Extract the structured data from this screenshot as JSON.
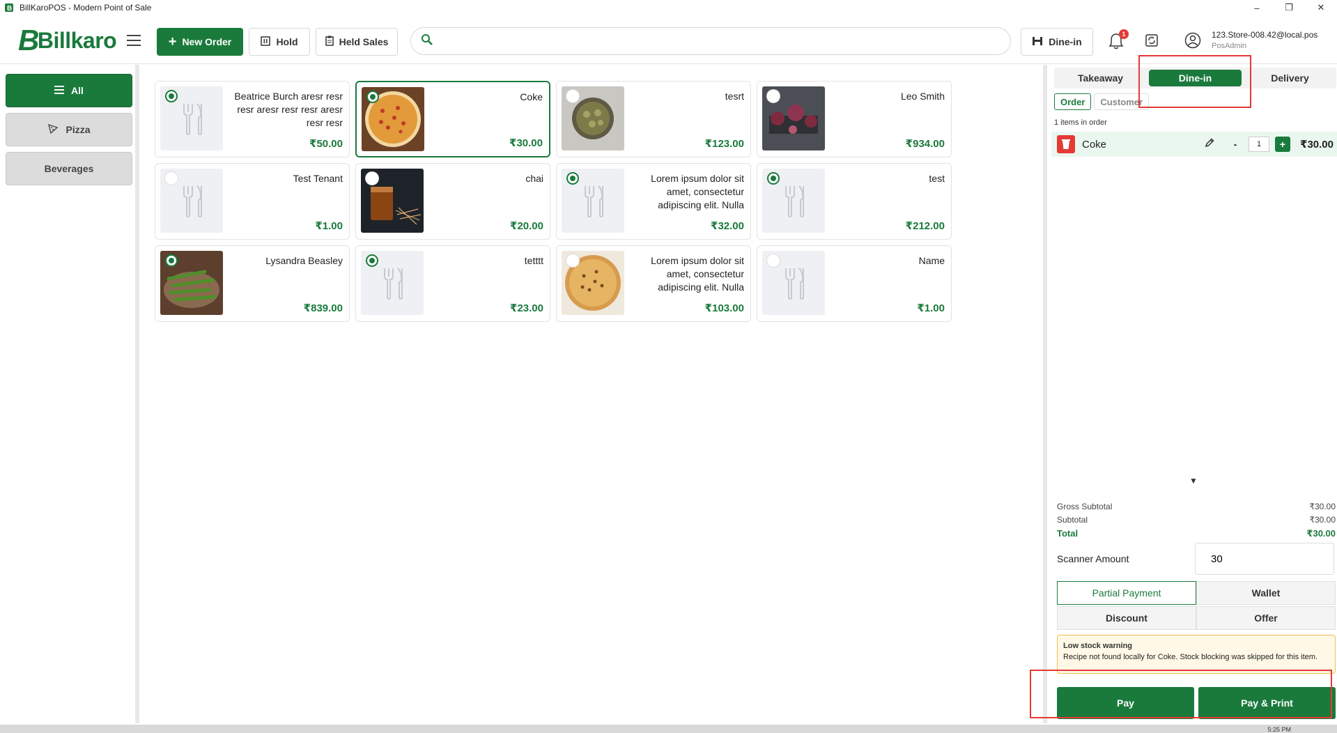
{
  "window": {
    "title": "BillKaroPOS - Modern Point of Sale",
    "controls": [
      "–",
      "❐",
      "✕"
    ]
  },
  "header": {
    "logo_text": "Billkaro",
    "logo_mark": "B",
    "new_order_label": "New Order",
    "hold_label": "Hold",
    "held_sales_label": "Held Sales",
    "search_placeholder": "",
    "order_type_label": "Dine-in",
    "notification_count": "1",
    "user_email": "123.Store-008.42@local.pos",
    "user_role": "PosAdmin"
  },
  "categories": [
    {
      "label": "All",
      "icon": "list-icon",
      "active": true
    },
    {
      "label": "Pizza",
      "icon": "pizza-icon",
      "active": false
    },
    {
      "label": "Beverages",
      "icon": "",
      "active": false
    }
  ],
  "products": [
    {
      "name": "Beatrice Burch  aresr resr resr aresr resr resr aresr resr resr",
      "price": "₹50.00",
      "image": "placeholder",
      "radio": "on",
      "selected": false
    },
    {
      "name": "Coke",
      "price": "₹30.00",
      "image": "pizza",
      "radio": "on",
      "selected": true
    },
    {
      "name": "tesrt",
      "price": "₹123.00",
      "image": "bowl",
      "radio": "off",
      "selected": false
    },
    {
      "name": "Leo Smith",
      "price": "₹934.00",
      "image": "onion",
      "radio": "off",
      "selected": false
    },
    {
      "name": "Test Tenant",
      "price": "₹1.00",
      "image": "placeholder",
      "radio": "off",
      "selected": false
    },
    {
      "name": "chai",
      "price": "₹20.00",
      "image": "tea",
      "radio": "off",
      "selected": false
    },
    {
      "name": "Lorem ipsum dolor sit amet, consectetur adipiscing elit. Nulla",
      "price": "₹32.00",
      "image": "placeholder",
      "radio": "on",
      "selected": false
    },
    {
      "name": "test",
      "price": "₹212.00",
      "image": "placeholder",
      "radio": "on",
      "selected": false
    },
    {
      "name": "Lysandra Beasley",
      "price": "₹839.00",
      "image": "chili",
      "radio": "on",
      "selected": false
    },
    {
      "name": "tetttt",
      "price": "₹23.00",
      "image": "placeholder",
      "radio": "on",
      "selected": false
    },
    {
      "name": "Lorem ipsum dolor sit amet, consectetur adipiscing elit. Nulla",
      "price": "₹103.00",
      "image": "pizza2",
      "radio": "off",
      "selected": false
    },
    {
      "name": "Name",
      "price": "₹1.00",
      "image": "placeholder",
      "radio": "off",
      "selected": false
    }
  ],
  "order_panel": {
    "tabs": [
      {
        "label": "Takeaway",
        "active": false
      },
      {
        "label": "Dine-in",
        "active": true
      },
      {
        "label": "Delivery",
        "active": false
      }
    ],
    "sub_tabs": [
      {
        "label": "Order",
        "active": true
      },
      {
        "label": "Customer",
        "active": false
      }
    ],
    "items_count": "1 items in order",
    "items": [
      {
        "name": "Coke",
        "qty": "1",
        "total": "₹30.00",
        "minus": "-",
        "plus": "+"
      }
    ],
    "caret": "▼",
    "totals": {
      "gross_label": "Gross Subtotal",
      "gross_value": "₹30.00",
      "sub_label": "Subtotal",
      "sub_value": "₹30.00",
      "total_label": "Total",
      "total_value": "₹30.00"
    },
    "scanner_label": "Scanner Amount",
    "scanner_value": "30",
    "payment_options": [
      {
        "label": "Partial Payment",
        "active": true
      },
      {
        "label": "Wallet",
        "active": false
      },
      {
        "label": "Discount",
        "active": false
      },
      {
        "label": "Offer",
        "active": false
      }
    ],
    "warning": {
      "title": "Low stock warning",
      "message": "Recipe not found locally for Coke. Stock blocking was skipped for this item."
    },
    "pay_label": "Pay",
    "pay_print_label": "Pay & Print"
  },
  "taskbar": {
    "clock": "5:25 PM"
  },
  "colors": {
    "brand": "#1a7a3c",
    "highlight": "#e53935",
    "warning_bg": "#fff8e6"
  }
}
